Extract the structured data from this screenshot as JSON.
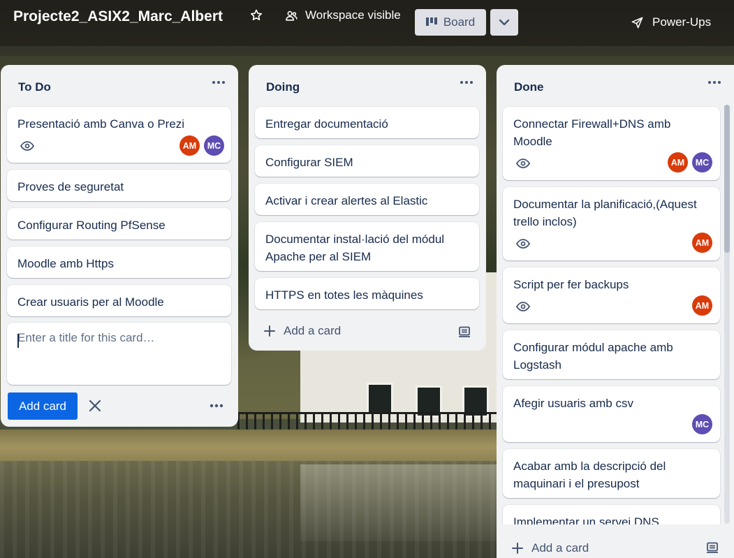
{
  "header": {
    "board_title": "Projecte2_ASIX2_Marc_Albert",
    "visibility_label": "Workspace visible",
    "view_label": "Board",
    "powerups_label": "Power-Ups",
    "icons": [
      "star-icon",
      "workspace-icon",
      "board-view-icon",
      "chevron-down-icon",
      "rocket-icon"
    ]
  },
  "lists": [
    {
      "title": "To Do",
      "cards": [
        {
          "title": "Presentació amb Canva o Prezi",
          "watching": true,
          "members": [
            "AM",
            "MC"
          ]
        },
        {
          "title": "Proves de seguretat"
        },
        {
          "title": "Configurar Routing PfSense"
        },
        {
          "title": "Moodle amb Https"
        },
        {
          "title": "Crear usuaris per al Moodle"
        }
      ],
      "composer": {
        "placeholder": "Enter a title for this card…",
        "submit_label": "Add card"
      }
    },
    {
      "title": "Doing",
      "cards": [
        {
          "title": "Entregar documentació"
        },
        {
          "title": "Configurar SIEM"
        },
        {
          "title": "Activar i crear alertes al Elastic"
        },
        {
          "title": "Documentar instal·lació del módul Apache per al SIEM"
        },
        {
          "title": "HTTPS en totes les màquines"
        }
      ],
      "add_card_label": "Add a card"
    },
    {
      "title": "Done",
      "cards": [
        {
          "title": "Connectar Firewall+DNS amb Moodle",
          "watching": true,
          "members": [
            "AM",
            "MC"
          ]
        },
        {
          "title": "Documentar la planificació,(Aquest trello inclos)",
          "watching": true,
          "members": [
            "AM"
          ]
        },
        {
          "title": "Script per fer backups",
          "watching": true,
          "members": [
            "AM"
          ]
        },
        {
          "title": "Configurar módul apache amb Logstash"
        },
        {
          "title": "Afegir usuaris amb csv",
          "members": [
            "MC"
          ]
        },
        {
          "title": "Acabar amb la descripció del maquinari i el presupost"
        },
        {
          "title": "Implementar un servei DNS"
        }
      ],
      "add_card_label": "Add a card"
    }
  ],
  "colors": {
    "list_bg": "#f1f2f4",
    "primary_button": "#0c66e4",
    "avatar_am": "#d93b0b",
    "avatar_mc": "#5e4db2"
  }
}
